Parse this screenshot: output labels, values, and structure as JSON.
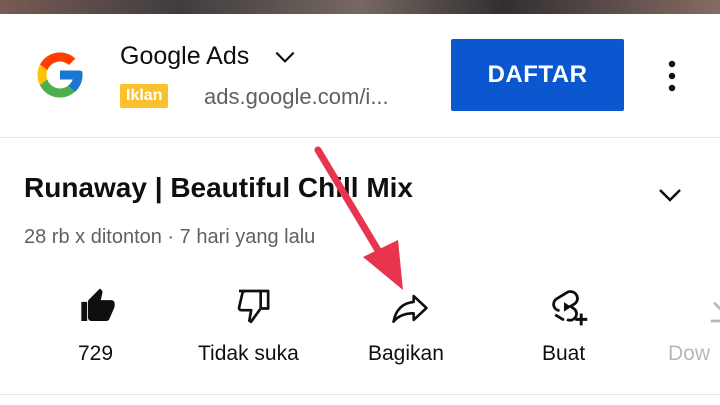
{
  "ad": {
    "advertiser": "Google Ads",
    "badge": "Iklan",
    "url": "ads.google.com/i...",
    "cta": "DAFTAR",
    "brand_colors": {
      "blue": "#4285F4",
      "red": "#EA4335",
      "yellow": "#FBBC05",
      "green": "#34A853"
    },
    "cta_color": "#0b57d0",
    "badge_color": "#fbc02d"
  },
  "video": {
    "title": "Runaway | Beautiful Chill Mix",
    "meta": "28 rb x ditonton · 7 hari yang lalu"
  },
  "actions": [
    {
      "label": "729",
      "icon": "thumbs-up-filled-icon"
    },
    {
      "label": "Tidak suka",
      "icon": "thumbs-down-icon"
    },
    {
      "label": "Bagikan",
      "icon": "share-icon"
    },
    {
      "label": "Buat",
      "icon": "create-icon"
    },
    {
      "label": "Dow",
      "icon": "download-icon"
    }
  ],
  "annotation": {
    "arrow_color": "#e8344e"
  }
}
